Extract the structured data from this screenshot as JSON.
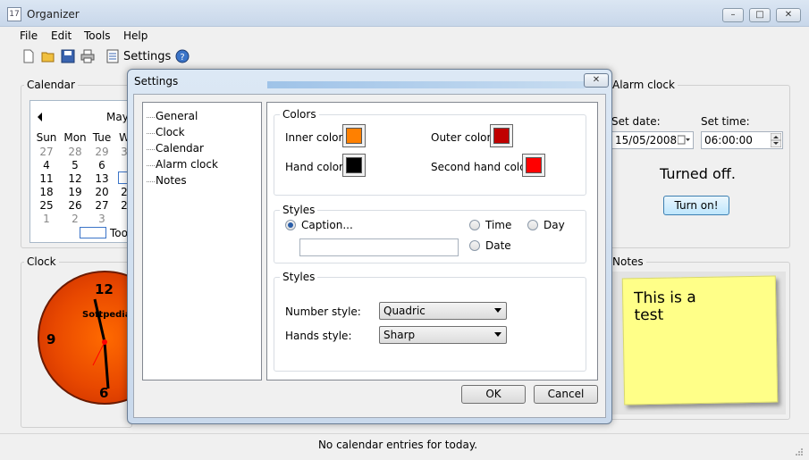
{
  "app": {
    "title": "Organizer"
  },
  "window_controls": {
    "minimize": "–",
    "maximize": "□",
    "close": "✕"
  },
  "menu": [
    "File",
    "Edit",
    "Tools",
    "Help"
  ],
  "toolbar": {
    "settings_label": "Settings",
    "icons": [
      "new-icon",
      "open-icon",
      "save-icon",
      "print-icon",
      "settings-icon",
      "help-icon"
    ]
  },
  "calendar": {
    "group_label": "Calendar",
    "month_label": "May",
    "day_headers": [
      "Sun",
      "Mon",
      "Tue",
      "W"
    ],
    "rows": [
      [
        "27",
        "28",
        "29",
        "3"
      ],
      [
        "4",
        "5",
        "6",
        ""
      ],
      [
        "11",
        "12",
        "13",
        ""
      ],
      [
        "18",
        "19",
        "20",
        "2"
      ],
      [
        "25",
        "26",
        "27",
        "2"
      ],
      [
        "1",
        "2",
        "3",
        ""
      ]
    ],
    "today_label": "Too"
  },
  "clock": {
    "group_label": "Clock",
    "numerals": {
      "top": "12",
      "left": "9",
      "bottom": "6"
    },
    "watermark": "Softpedia"
  },
  "alarm": {
    "group_label": "Alarm clock",
    "set_date_label": "Set date:",
    "date_value": "15/05/2008",
    "set_time_label": "Set time:",
    "time_value": "06:00:00",
    "status": "Turned off.",
    "button": "Turn on!"
  },
  "notes": {
    "group_label": "Notes",
    "text": "This is a\ntest"
  },
  "status_bar": {
    "text": "No calendar entries for today."
  },
  "dialog": {
    "title": "Settings",
    "close_glyph": "✕",
    "nav": [
      "General",
      "Clock",
      "Calendar",
      "Alarm clock",
      "Notes"
    ],
    "colors": {
      "group_label": "Colors",
      "inner_label": "Inner color:",
      "inner_color": "#ff8000",
      "outer_label": "Outer color:",
      "outer_color": "#c00000",
      "hand_label": "Hand color:",
      "hand_color": "#000000",
      "second_label": "Second hand color:",
      "second_color": "#ff0000"
    },
    "caption_styles": {
      "group_label": "Styles",
      "caption_option": "Caption...",
      "time_option": "Time",
      "day_option": "Day",
      "date_option": "Date",
      "caption_value": ""
    },
    "styles": {
      "group_label": "Styles",
      "number_style_label": "Number style:",
      "number_style_value": "Quadric",
      "hands_style_label": "Hands style:",
      "hands_style_value": "Sharp"
    },
    "ok": "OK",
    "cancel": "Cancel"
  }
}
